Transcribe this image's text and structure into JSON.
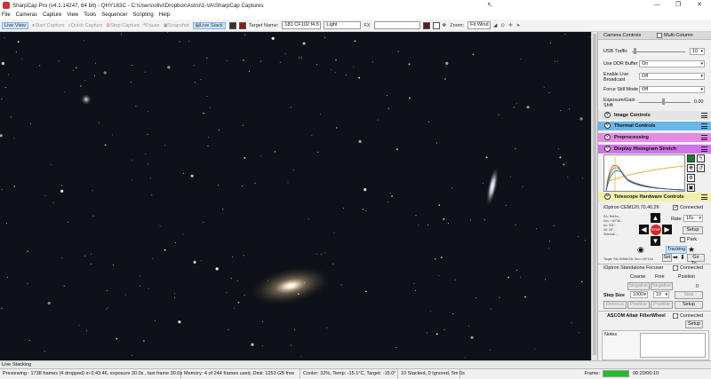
{
  "window": {
    "title": "SharpCap Pro (v4.1.14247, 64 bit) - QHY183C - C:\\Users\\olivi\\Dropbox\\Astro\\1-VA\\SharpCap Captures",
    "min": "—",
    "max": "❐",
    "close": "✕"
  },
  "menu": [
    "File",
    "Cameras",
    "Capture",
    "View",
    "Tools",
    "Sequencer",
    "Scripting",
    "Help"
  ],
  "toolbar": {
    "live_view": "Live View",
    "start_capture": "Start Capture",
    "quick_capture": "Quick Capture",
    "stop_capture": "Stop Capture",
    "pause": "Pause",
    "snapshot": "Snapshot",
    "live_stack": "Live Stack",
    "target_name_label": "Target Name:",
    "target_name_value": "181 CF102 f4.5",
    "frame_type": "Light",
    "fx_label": "FX",
    "zoom_label": "Zoom:",
    "zoom_value": "Fit Wind"
  },
  "panel": {
    "camera_controls_title": "Camera Controls",
    "multi_column": "Multi Column",
    "usb_traffic_label": "USB Traffic",
    "usb_traffic_value": "10",
    "ddr_label": "Use DDR Buffer",
    "ddr_value": "On",
    "live_broadcast_label": "Enable Live Broadcast",
    "live_broadcast_value": "Off",
    "force_still_label": "Force Still Mode",
    "force_still_value": "Off",
    "exposure_gain_label": "Exposure/Gain Shift",
    "exposure_gain_value": "0.00",
    "groups": {
      "image": "Image Controls",
      "thermal": "Thermal Controls",
      "preprocessing": "Preprocessing",
      "histogram": "Display Histogram Stretch",
      "telescope": "Telescope Hardware Controls"
    },
    "telescope": {
      "mount": "iOptron CEM120,70,40,26",
      "connected": "Connected",
      "rate_label": "Rate:",
      "rate_value": "16x",
      "setup": "Setup",
      "park": "Park",
      "tracking": "Tracking",
      "stop": "STOP",
      "set": "Set",
      "goto": "Go To...",
      "coords": [
        "RA: 9h53m...",
        "Dec: +69°06'...",
        "Az: 331°..",
        "Alt: 45°...",
        "Sidereal: ..."
      ],
      "target_line": "Target: RA=9h55m33s Dec=+69°11m"
    },
    "focuser": {
      "name": "iOptron Standalone Focuser",
      "connected": "Connected",
      "coarse": "Coarse",
      "fine": "Fine",
      "position": "Position",
      "negative1": "Negative",
      "negative2": "Negative",
      "position_value": "0",
      "step_size_label": "Step Size",
      "step1": "1000",
      "step2": "10",
      "stop": "Stop",
      "refocus": "Refocus",
      "positive1": "Positive",
      "positive2": "Positive",
      "setup": "Setup"
    },
    "filterwheel": {
      "name": "ASCOM Altair FilterWheel",
      "connected": "Connected",
      "setup": "Setup"
    },
    "notes_label": "Notes"
  },
  "status": {
    "live_stacking": "Live Stacking",
    "previewing": "Previewing : 1738 frames (4 dropped) in 0:43:46, exposure 30.0s , last frame 30.0s",
    "memory": "Memory: 4 of 244 frames used, Disk: 1253 GB free",
    "cooler": "Cooler: 32%, Temp: -15.1°C, Target: -15.0°",
    "stacked": "10 Stacked, 0 Ignored, 5m 0s",
    "frame_label": "Frame:",
    "frame_time": "00:20/00:10",
    "frame_progress": 1.0
  },
  "colors": {
    "accent_blue": "#6ab7e8",
    "preprocessing_pink": "#e58ae5",
    "histogram_purple": "#ce73e8",
    "telescope_yellow": "#f3f1a6",
    "progress_green": "#1fbf2a",
    "stop_red": "#e02020"
  }
}
